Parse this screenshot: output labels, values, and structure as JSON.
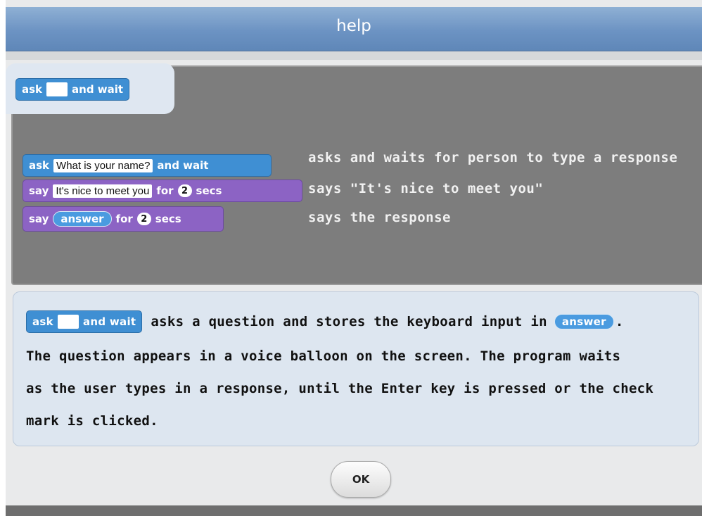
{
  "window": {
    "title": "help"
  },
  "palette_block": {
    "ask": "ask",
    "and_wait": "and wait"
  },
  "example_script": {
    "rows": [
      {
        "kw": "ask",
        "input": "What is your name?",
        "tail": "and wait",
        "description": "asks and waits for person to type a response"
      },
      {
        "kw": "say",
        "input": "It's nice to meet you",
        "for": "for",
        "secs_value": "2",
        "secs": "secs",
        "description": "says \"It's nice to meet you\""
      },
      {
        "kw": "say",
        "reporter": "answer",
        "for": "for",
        "secs_value": "2",
        "secs": "secs",
        "description": "says the response"
      }
    ]
  },
  "help_text": {
    "block_ask": "ask",
    "block_and_wait": "and wait",
    "line1": "asks a question and stores the keyboard input in",
    "answer_reporter": "answer",
    "line1_end": ".",
    "line2": "The question appears in a voice balloon on the screen. The program waits",
    "line3": "as the user types in a response, until the Enter key is pressed or the check",
    "line4": "mark is clicked."
  },
  "footer": {
    "ok_label": "OK"
  },
  "colors": {
    "title_bar": "#6c93c3",
    "script_area": "#7d7d7d",
    "sensing_block": "#3f8fd3",
    "looks_block": "#8c63c4",
    "help_panel": "#dde6f0"
  }
}
